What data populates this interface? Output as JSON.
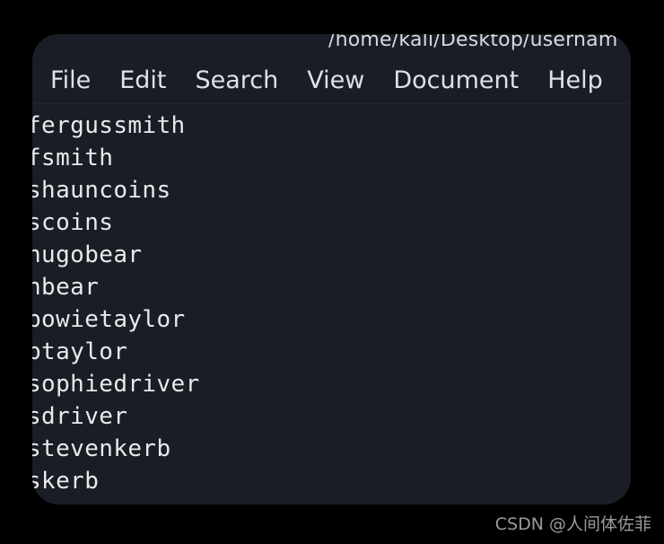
{
  "window": {
    "title": "/home/kali/Desktop/usernam",
    "background_color": "#1a1d26",
    "text_color": "#e9e9e9",
    "page_background": "#000000"
  },
  "menu": {
    "items": [
      {
        "label": "File"
      },
      {
        "label": "Edit"
      },
      {
        "label": "Search"
      },
      {
        "label": "View"
      },
      {
        "label": "Document"
      },
      {
        "label": "Help"
      }
    ]
  },
  "document": {
    "lines": [
      "fergussmith",
      "fsmith",
      "shauncoins",
      "scoins",
      "hugobear",
      "hbear",
      "bowietaylor",
      "btaylor",
      "sophiedriver",
      "sdriver",
      "stevenkerb",
      "skerb"
    ]
  },
  "watermark": {
    "text": "CSDN @人间体佐菲"
  }
}
